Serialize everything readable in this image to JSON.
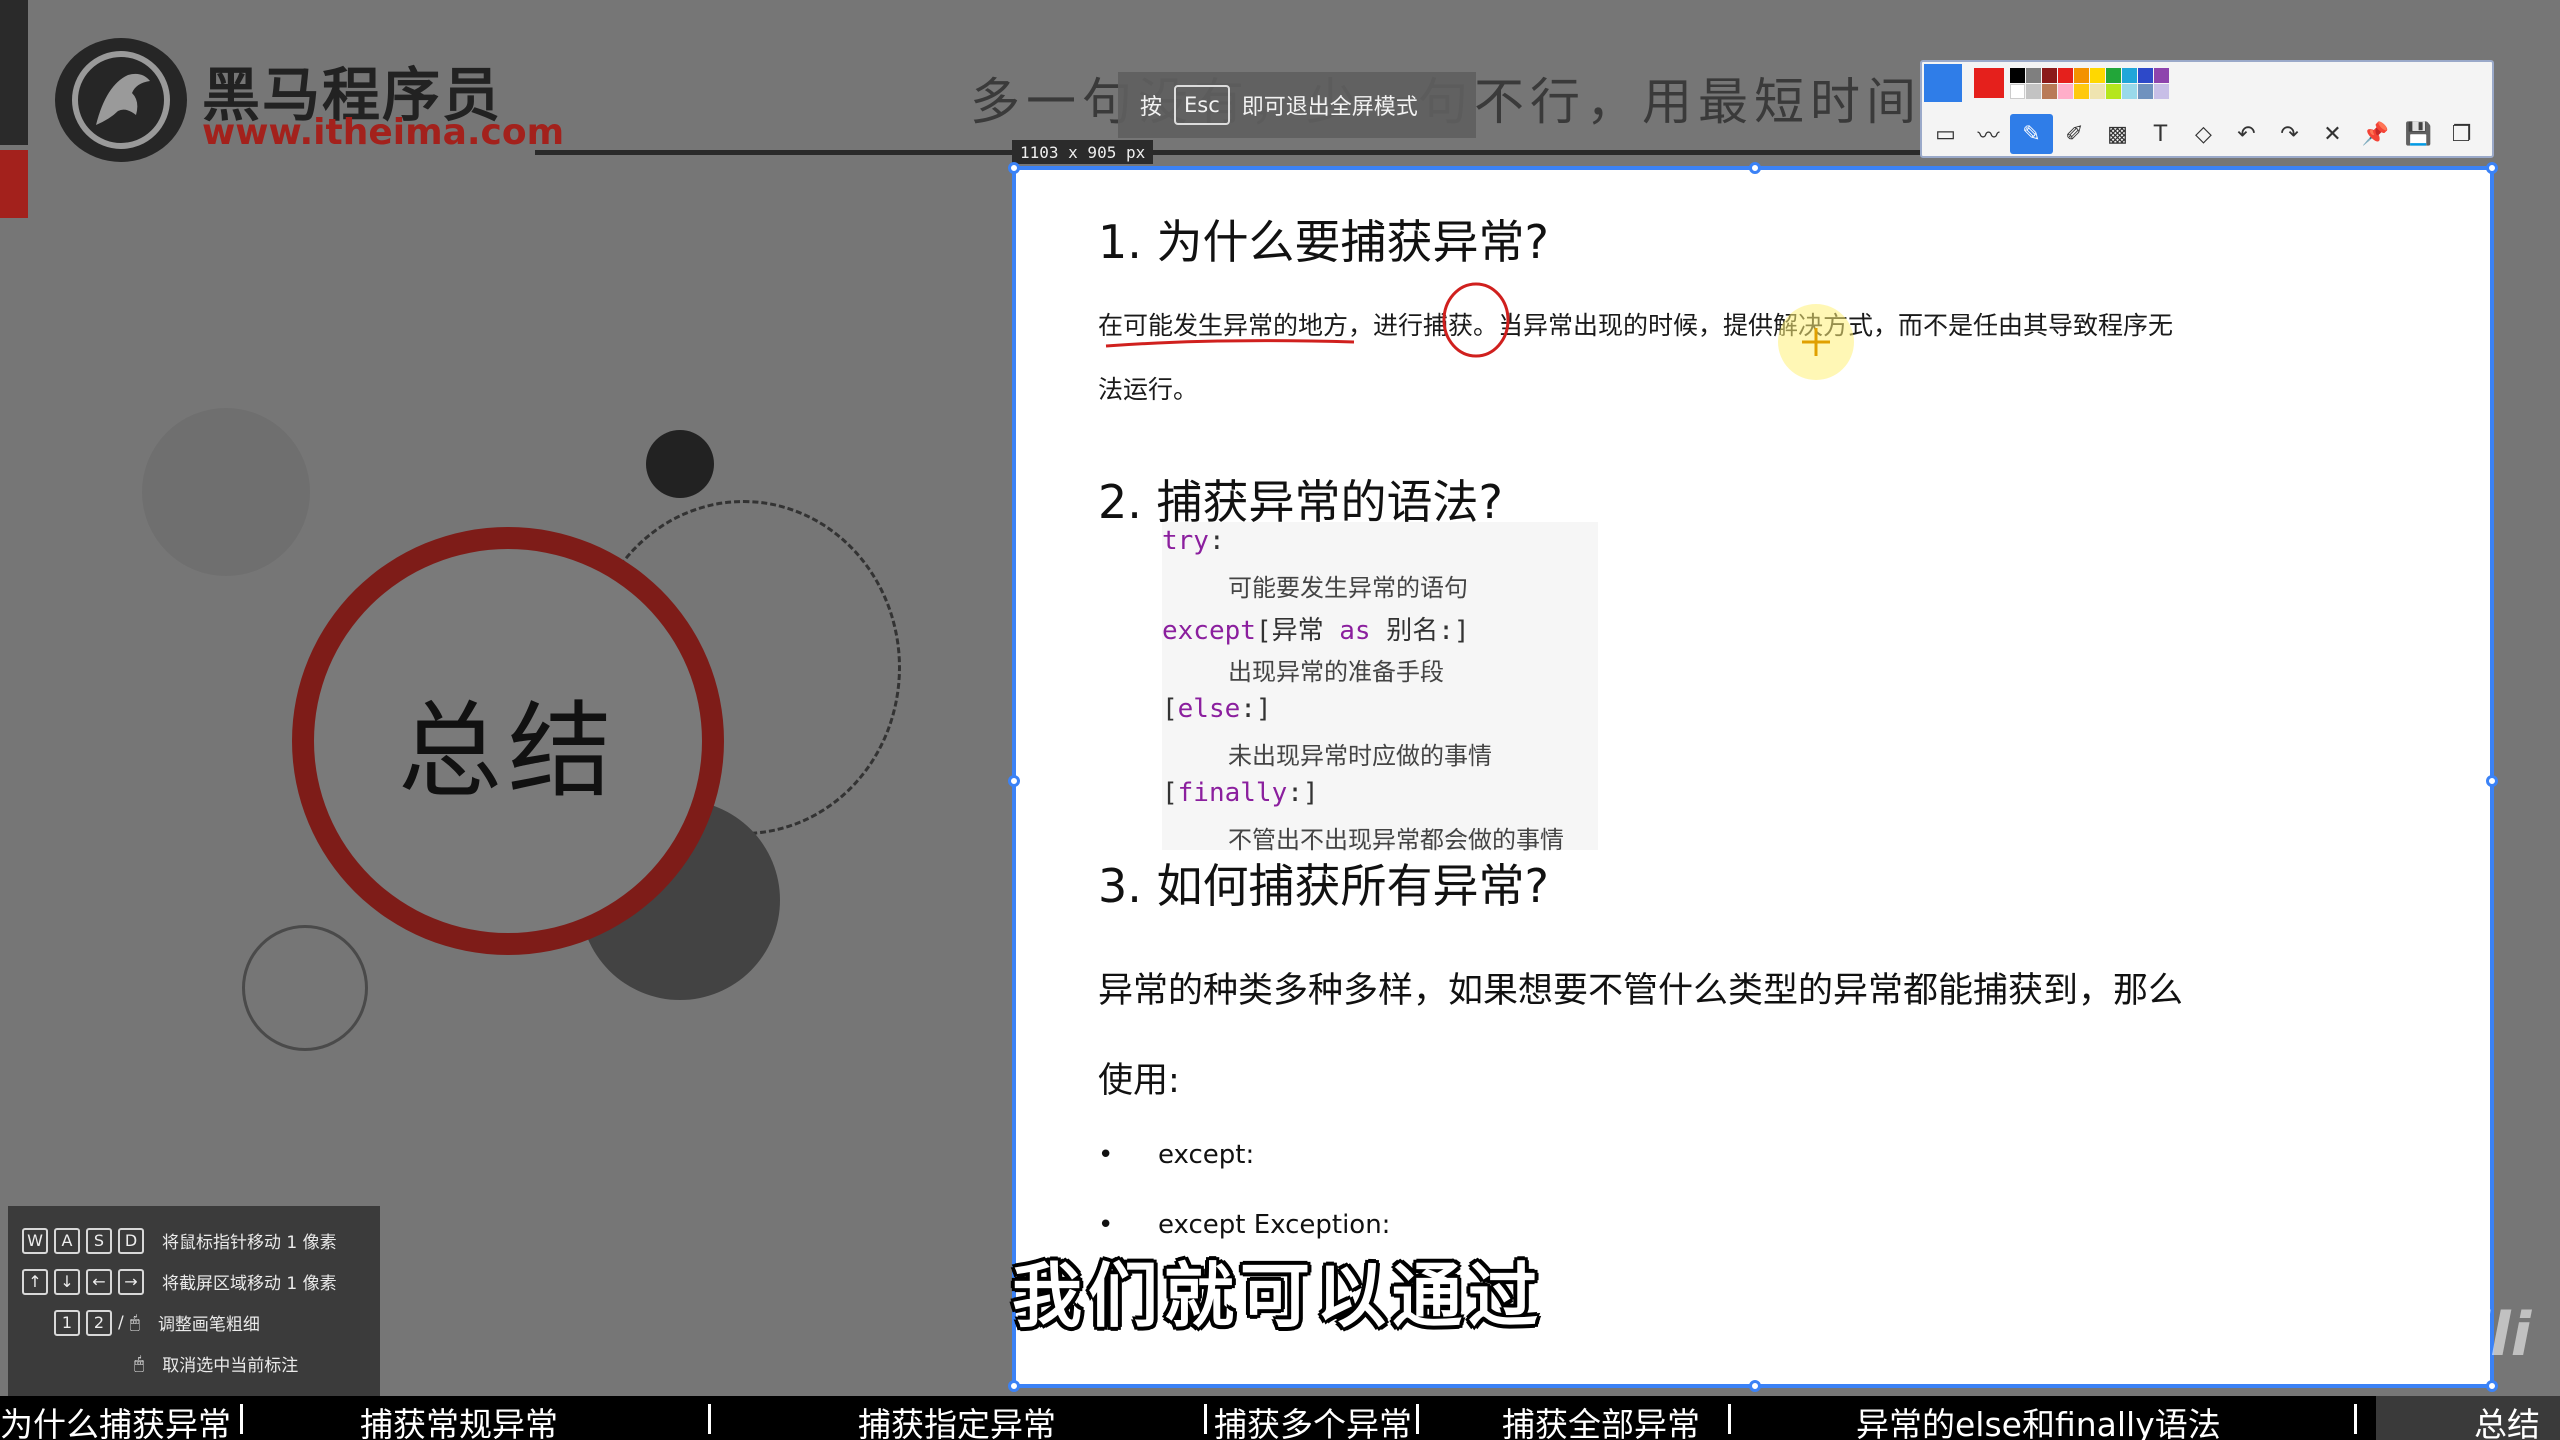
{
  "logo": {
    "title": "黑马程序员",
    "url": "www.itheima.com"
  },
  "slogan": "多一句没有，少一句不行，用最短时间，用的技术！",
  "esc_hint": {
    "prefix": "按",
    "key": "Esc",
    "suffix": "即可退出全屏模式"
  },
  "summary_title": "总结",
  "selection_size": "1103 x 905  px",
  "key_help": [
    {
      "keys": [
        "W",
        "A",
        "S",
        "D"
      ],
      "text": "将鼠标指针移动 1 像素"
    },
    {
      "keys": [
        "↑",
        "↓",
        "←",
        "→"
      ],
      "text": "将截屏区域移动 1 像素"
    },
    {
      "keys": [
        "1",
        "2",
        "/",
        "🖱"
      ],
      "text": "调整画笔粗细"
    },
    {
      "keys": [
        "🖱"
      ],
      "text": "取消选中当前标注"
    }
  ],
  "doc": {
    "sec1_title": "1. 为什么要捕获异常?",
    "sec1_line1": "在可能发生异常的地方，进行捕获。当异常出现的时候，提供解决方式，而不是任由其导致程序无",
    "sec1_line2": "法运行。",
    "sec2_title": "2. 捕获异常的语法?",
    "code": {
      "try": "try",
      "try_colon": ":",
      "try_body": "可能要发生异常的语句",
      "except": "except",
      "except_rest1": "[异常 ",
      "as": "as",
      "except_rest2": " 别名:]",
      "except_body": "出现异常的准备手段",
      "else_open": "[",
      "else": "else",
      "else_close": ":]",
      "else_body": "未出现异常时应做的事情",
      "finally_open": "[",
      "finally": "finally",
      "finally_close": ":]",
      "finally_body": "不管出不出现异常都会做的事情"
    },
    "sec3_title": "3. 如何捕获所有异常?",
    "sec3_line1": "异常的种类多种多样，如果想要不管什么类型的异常都能捕获到，那么",
    "sec3_line2": "使用:",
    "bullets": [
      "except:",
      "except Exception:"
    ]
  },
  "subtitle": "我们就可以通过",
  "watermark": "bilibili",
  "chapters": [
    "为什么捕获异常",
    "捕获常规异常",
    "捕获指定异常",
    "捕获多个异常",
    "捕获全部异常",
    "异常的else和finally语法",
    "总结"
  ],
  "colors": {
    "accent_red": "#a3211c",
    "selection_blue": "#3b82f6",
    "keyword_purple": "#8b1f9e"
  },
  "toolbar_tools": [
    "rect-icon",
    "line-icon",
    "pen-icon",
    "marker-icon",
    "mosaic-icon",
    "text-icon",
    "eraser-icon",
    "undo-icon",
    "redo-icon",
    "close-icon",
    "pin-icon",
    "save-icon",
    "copy-icon"
  ]
}
